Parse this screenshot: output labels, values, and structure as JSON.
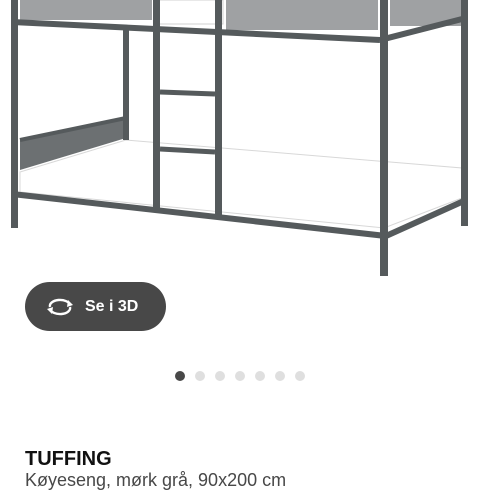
{
  "gallery": {
    "image_alt": "Bunk bed with dark grey metal frame and white mattresses",
    "slide_count": 7,
    "active_slide": 1
  },
  "view_3d": {
    "label": "Se i 3D",
    "icon": "rotate-360-icon"
  },
  "product": {
    "name": "TUFFING",
    "description_partial": "Køyeseng, mørk grå, 90x200 cm"
  },
  "colors": {
    "frame": "#555a5c",
    "button_bg": "#484848",
    "dot_active": "#484848",
    "dot_inactive": "#dfdfdf"
  }
}
